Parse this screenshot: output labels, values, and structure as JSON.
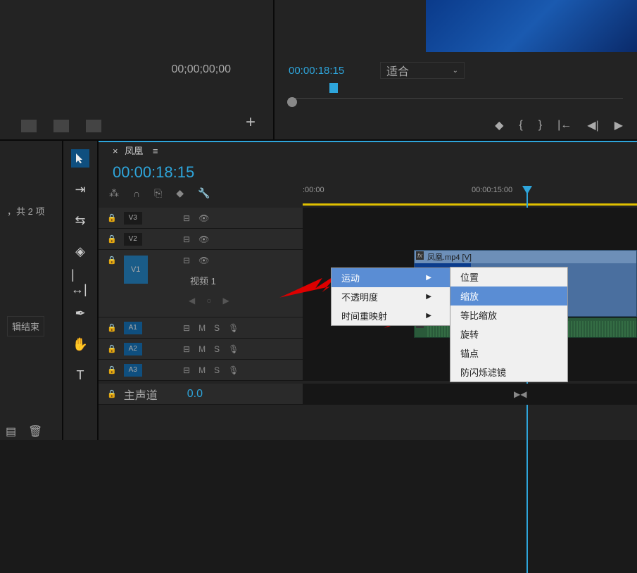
{
  "source": {
    "timecode": "00;00;00;00"
  },
  "program": {
    "timecode": "00:00:18:15",
    "fit_label": "适合"
  },
  "project": {
    "count_text": "，共 2 项",
    "end_label": "辑结束"
  },
  "timeline": {
    "tab_label": "凤凰",
    "timecode": "00:00:18:15",
    "ruler": {
      "t0": ":00:00",
      "t15": "00:00:15:00"
    },
    "tracks": {
      "v3": "V3",
      "v2": "V2",
      "v1": "V1",
      "v1_label": "视频 1",
      "a1": "A1",
      "a2": "A2",
      "a3": "A3",
      "mix": "主声道",
      "mix_val": "0.0",
      "m": "M",
      "s": "S"
    },
    "clip_v_label": "凤凰.mp4 [V]"
  },
  "menu1": {
    "motion": "运动",
    "opacity": "不透明度",
    "timeremap": "时间重映射"
  },
  "menu2": {
    "position": "位置",
    "scale": "缩放",
    "uniform": "等比缩放",
    "rotation": "旋转",
    "anchor": "锚点",
    "flicker": "防闪烁滤镜"
  },
  "icons": {
    "lock": "🔒",
    "eye": "👁",
    "mic": "🎙",
    "wrench": "🔧",
    "marker": "◆"
  }
}
